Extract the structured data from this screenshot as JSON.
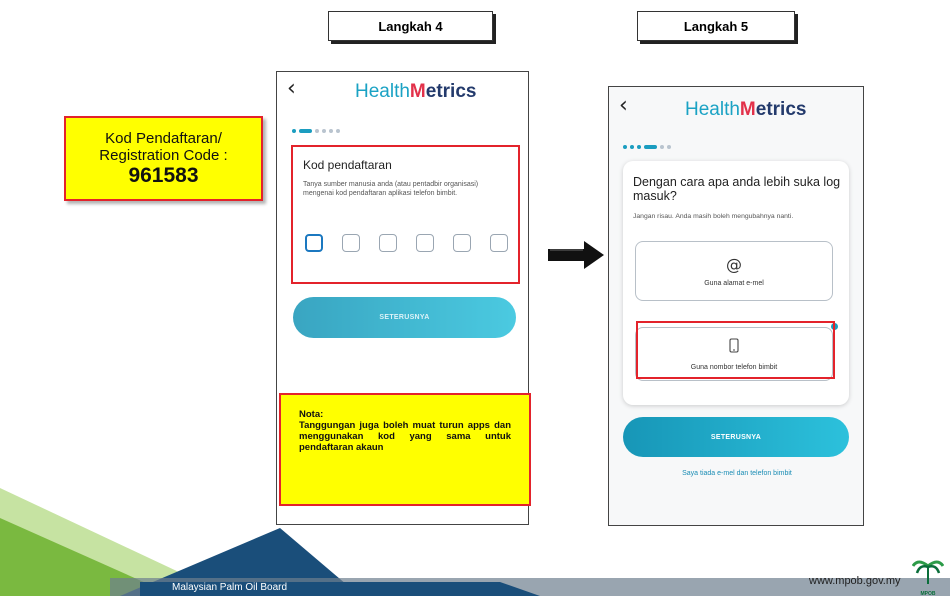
{
  "steps": {
    "step4_label": "Langkah 4",
    "step5_label": "Langkah 5"
  },
  "callout": {
    "line1": "Kod Pendaftaran/",
    "line2": "Registration Code :",
    "code": "961583"
  },
  "screen4": {
    "logo_prefix": "Health",
    "logo_m": "M",
    "logo_suffix": "etrics",
    "section_title": "Kod pendaftaran",
    "section_desc": "Tanya sumber manusia anda (atau pentadbir organisasi) mengenai kod pendaftaran aplikasi telefon bimbit.",
    "next_label": "SETERUSNYA"
  },
  "note": {
    "heading": "Nota:",
    "body": "Tanggungan juga boleh muat turun apps dan menggunakan kod yang sama untuk pendaftaran akaun"
  },
  "screen5": {
    "logo_prefix": "Health",
    "logo_m": "M",
    "logo_suffix": "etrics",
    "question": "Dengan cara apa anda lebih suka log masuk?",
    "hint": "Jangan risau. Anda masih boleh mengubahnya nanti.",
    "email_icon_glyph": "@",
    "email_option": "Guna alamat e-mel",
    "phone_option": "Guna nombor telefon bimbit",
    "next_label": "SETERUSNYA",
    "no_contact_link": "Saya tiada e-mel dan telefon bimbit"
  },
  "footer": {
    "org_name": "Malaysian Palm Oil Board",
    "website": "www.mpob.gov.my",
    "logo_text": "MPOB"
  },
  "colors": {
    "accent": "#1b9dc0",
    "callout_bg": "#ffff00",
    "highlight_red": "#e3232b",
    "footer_blue": "#1a4e7a",
    "footer_green": "#7ab940"
  },
  "icons": {
    "back": "chevron-left-icon",
    "arrow": "right-arrow-icon",
    "email": "at-sign-icon",
    "phone": "mobile-phone-icon",
    "mpob_logo": "palm-logo-icon"
  }
}
